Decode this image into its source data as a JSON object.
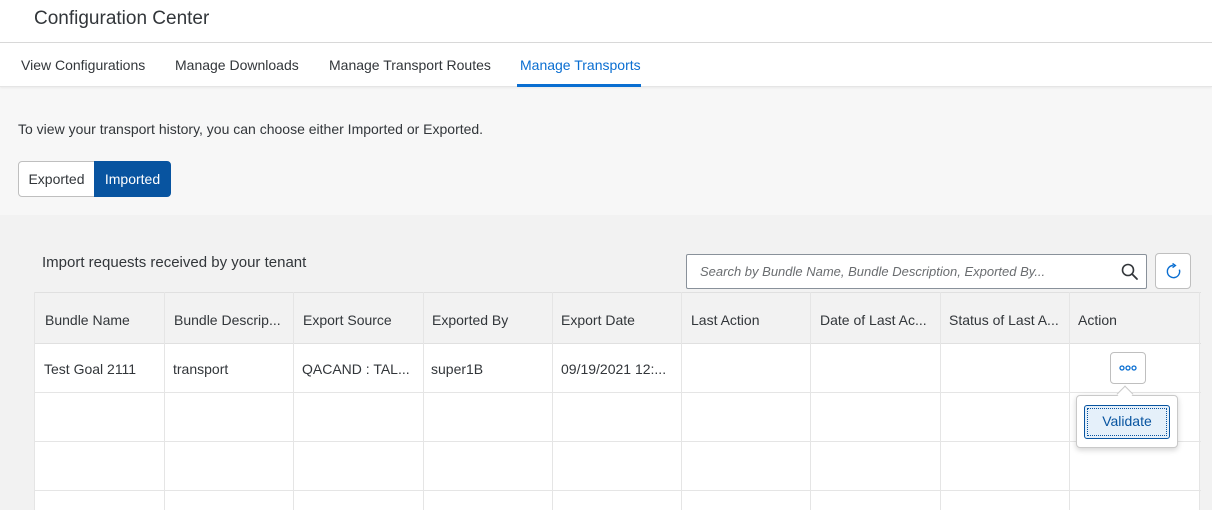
{
  "app": {
    "title": "Configuration Center"
  },
  "tabs": [
    {
      "label": "View Configurations"
    },
    {
      "label": "Manage Downloads"
    },
    {
      "label": "Manage Transport Routes"
    },
    {
      "label": "Manage Transports"
    }
  ],
  "active_tab": "Manage Transports",
  "hint_text": "To view your transport history, you can choose either Imported or Exported.",
  "toggle": {
    "exported": "Exported",
    "imported": "Imported",
    "selected": "Imported"
  },
  "table": {
    "title": "Import requests received by your tenant",
    "search_placeholder": "Search by Bundle Name, Bundle Description, Exported By...",
    "columns": [
      "Bundle Name",
      "Bundle Descrip...",
      "Export Source",
      "Exported By",
      "Export Date",
      "Last Action",
      "Date of Last Ac...",
      "Status of Last A...",
      "Action"
    ],
    "rows": [
      {
        "bundle_name": "Test Goal 2111",
        "bundle_description": "transport",
        "export_source": "QACAND : TAL...",
        "exported_by": "super1B",
        "export_date": "09/19/2021 12:...",
        "last_action": "",
        "date_last_action": "",
        "status_last_action": ""
      }
    ]
  },
  "popover": {
    "validate_label": "Validate"
  },
  "colors": {
    "accent": "#0a6ed1",
    "selected_button": "#0854a0",
    "text": "#32363a"
  },
  "icons": {
    "search": "search-icon",
    "refresh": "refresh-icon",
    "more": "more-icon"
  }
}
